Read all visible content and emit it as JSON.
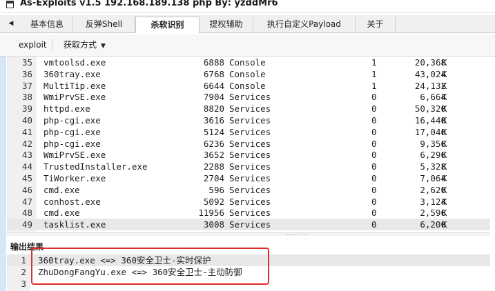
{
  "window": {
    "title": "As-Exploits v1.5 192.168.189.138 php By: yzddMr6"
  },
  "tabs": [
    {
      "label": "基本信息",
      "active": false
    },
    {
      "label": "反弹Shell",
      "active": false
    },
    {
      "label": "杀软识别",
      "active": true
    },
    {
      "label": "提权辅助",
      "active": false
    },
    {
      "label": "执行自定义Payload",
      "active": false
    },
    {
      "label": "关于",
      "active": false
    }
  ],
  "toolbar": {
    "exploit_label": "exploit",
    "fetch_label": "获取方式"
  },
  "process_rows": [
    {
      "ln": "35",
      "name": "vmtoolsd.exe",
      "pid": "6888",
      "session": "Console",
      "num": "1",
      "mem": "20,368",
      "unit": "K"
    },
    {
      "ln": "36",
      "name": "360tray.exe",
      "pid": "6768",
      "session": "Console",
      "num": "1",
      "mem": "43,024",
      "unit": "K"
    },
    {
      "ln": "37",
      "name": "MultiTip.exe",
      "pid": "6644",
      "session": "Console",
      "num": "1",
      "mem": "24,132",
      "unit": "K"
    },
    {
      "ln": "38",
      "name": "WmiPrvSE.exe",
      "pid": "7904",
      "session": "Services",
      "num": "0",
      "mem": "6,664",
      "unit": "K"
    },
    {
      "ln": "39",
      "name": "httpd.exe",
      "pid": "8820",
      "session": "Services",
      "num": "0",
      "mem": "50,320",
      "unit": "K"
    },
    {
      "ln": "40",
      "name": "php-cgi.exe",
      "pid": "3616",
      "session": "Services",
      "num": "0",
      "mem": "16,440",
      "unit": "K"
    },
    {
      "ln": "41",
      "name": "php-cgi.exe",
      "pid": "5124",
      "session": "Services",
      "num": "0",
      "mem": "17,040",
      "unit": "K"
    },
    {
      "ln": "42",
      "name": "php-cgi.exe",
      "pid": "6236",
      "session": "Services",
      "num": "0",
      "mem": "9,356",
      "unit": "K"
    },
    {
      "ln": "43",
      "name": "WmiPrvSE.exe",
      "pid": "3652",
      "session": "Services",
      "num": "0",
      "mem": "6,296",
      "unit": "K"
    },
    {
      "ln": "44",
      "name": "TrustedInstaller.exe",
      "pid": "2288",
      "session": "Services",
      "num": "0",
      "mem": "5,328",
      "unit": "K"
    },
    {
      "ln": "45",
      "name": "TiWorker.exe",
      "pid": "2704",
      "session": "Services",
      "num": "0",
      "mem": "7,064",
      "unit": "K"
    },
    {
      "ln": "46",
      "name": "cmd.exe",
      "pid": "596",
      "session": "Services",
      "num": "0",
      "mem": "2,620",
      "unit": "K"
    },
    {
      "ln": "47",
      "name": "conhost.exe",
      "pid": "5092",
      "session": "Services",
      "num": "0",
      "mem": "3,124",
      "unit": "K"
    },
    {
      "ln": "48",
      "name": "cmd.exe",
      "pid": "11956",
      "session": "Services",
      "num": "0",
      "mem": "2,596",
      "unit": "K"
    },
    {
      "ln": "49",
      "name": "tasklist.exe",
      "pid": "3008",
      "session": "Services",
      "num": "0",
      "mem": "6,200",
      "unit": "K"
    }
  ],
  "output": {
    "header": "输出结果",
    "lines": [
      {
        "ln": "1",
        "text": "360tray.exe <=> 360安全卫士-实时保护"
      },
      {
        "ln": "2",
        "text": "ZhuDongFangYu.exe <=> 360安全卫士-主动防御"
      },
      {
        "ln": "3",
        "text": ""
      }
    ]
  },
  "colors": {
    "highlight_border": "#e02c2c",
    "selected_row": "#e8e8e8"
  }
}
